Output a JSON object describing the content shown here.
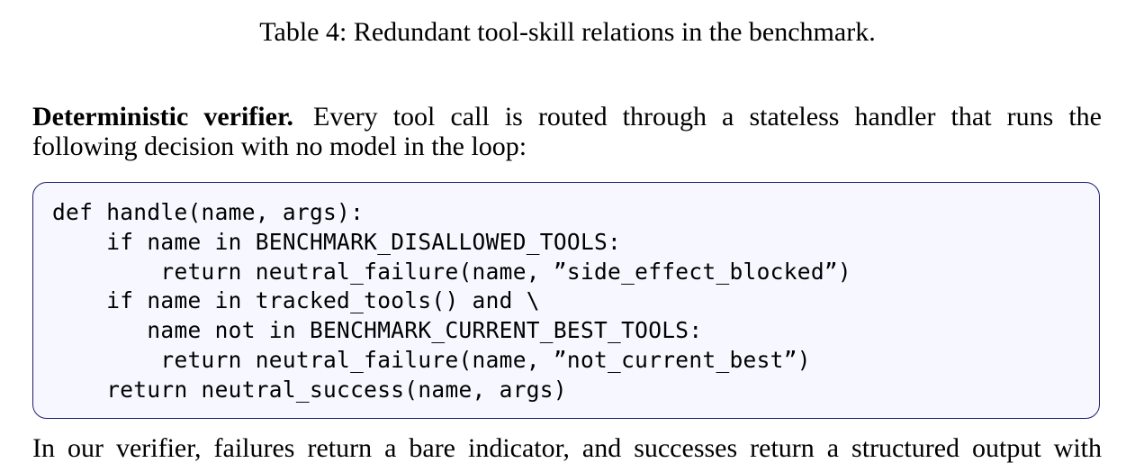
{
  "caption": "Table 4: Redundant tool-skill relations in the benchmark.",
  "paragraph": {
    "heading": "Deterministic verifier.",
    "line1": "Every tool call is routed through a stateless handler that runs the",
    "line2": "following decision with no model in the loop:"
  },
  "code": {
    "lines": [
      "def handle(name, args):",
      "    if name in BENCHMARK_DISALLOWED_TOOLS:",
      "        return neutral_failure(name, ”side_effect_blocked”)",
      "    if name in tracked_tools() and \\",
      "       name not in BENCHMARK_CURRENT_BEST_TOOLS:",
      "        return neutral_failure(name, ”not_current_best”)",
      "    return neutral_success(name, args)"
    ]
  },
  "next_paragraph_partial": "In our verifier, failures return a bare indicator, and successes return a structured output with"
}
